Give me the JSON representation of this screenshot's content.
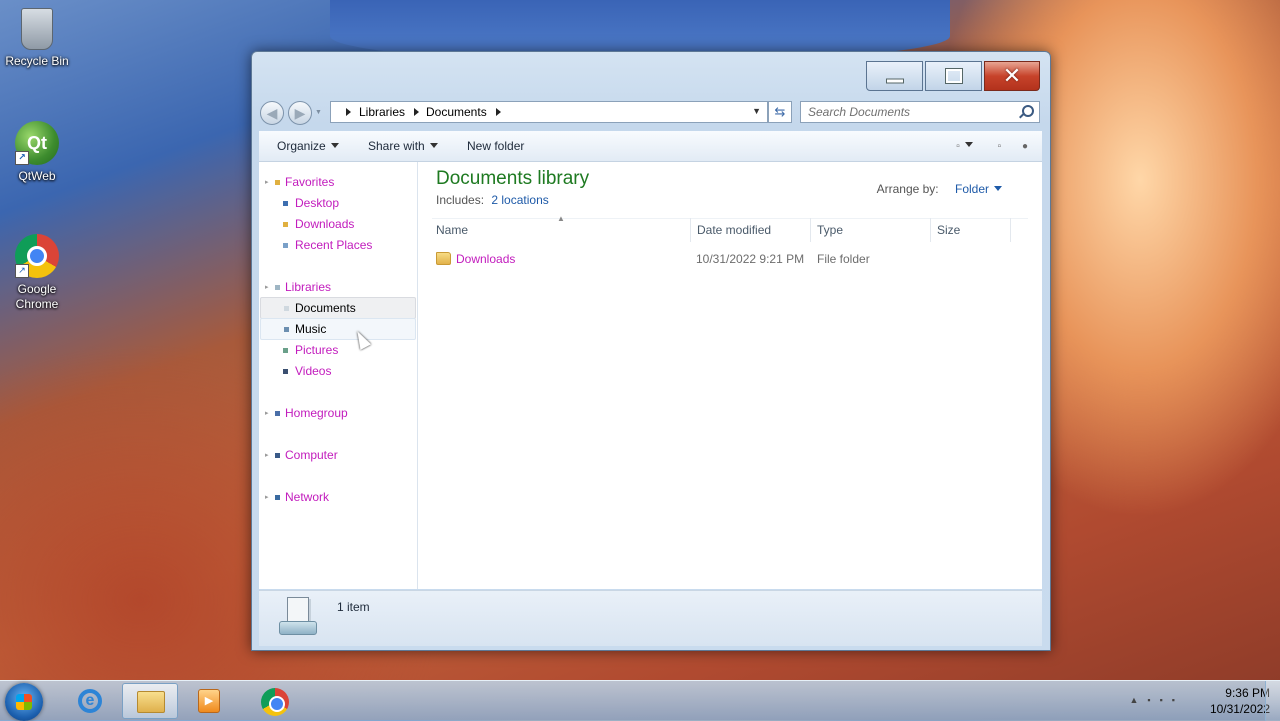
{
  "desktop": {
    "icons": [
      {
        "label": "Recycle Bin"
      },
      {
        "label": "QtWeb"
      },
      {
        "label": "Google Chrome"
      }
    ]
  },
  "window": {
    "address": {
      "segments": [
        "Libraries",
        "Documents"
      ]
    },
    "search_placeholder": "Search Documents",
    "toolbar": {
      "organize": "Organize",
      "share_with": "Share with",
      "new_folder": "New folder"
    },
    "nav": {
      "favorites": {
        "label": "Favorites",
        "items": [
          "Desktop",
          "Downloads",
          "Recent Places"
        ]
      },
      "libraries": {
        "label": "Libraries",
        "items": [
          "Documents",
          "Music",
          "Pictures",
          "Videos"
        ]
      },
      "homegroup": "Homegroup",
      "computer": "Computer",
      "network": "Network"
    },
    "library": {
      "title": "Documents library",
      "includes_label": "Includes:",
      "includes_link": "2 locations",
      "arrange_label": "Arrange by:",
      "arrange_value": "Folder"
    },
    "columns": [
      "Name",
      "Date modified",
      "Type",
      "Size"
    ],
    "rows": [
      {
        "name": "Downloads",
        "date": "10/31/2022 9:21 PM",
        "type": "File folder",
        "size": ""
      }
    ],
    "status": "1 item"
  },
  "taskbar": {
    "time": "9:36 PM",
    "date": "10/31/2022"
  },
  "colors": {
    "nav_link": "#c21cbd",
    "library_title": "#1e7a21",
    "link_blue": "#1e5aa8"
  }
}
